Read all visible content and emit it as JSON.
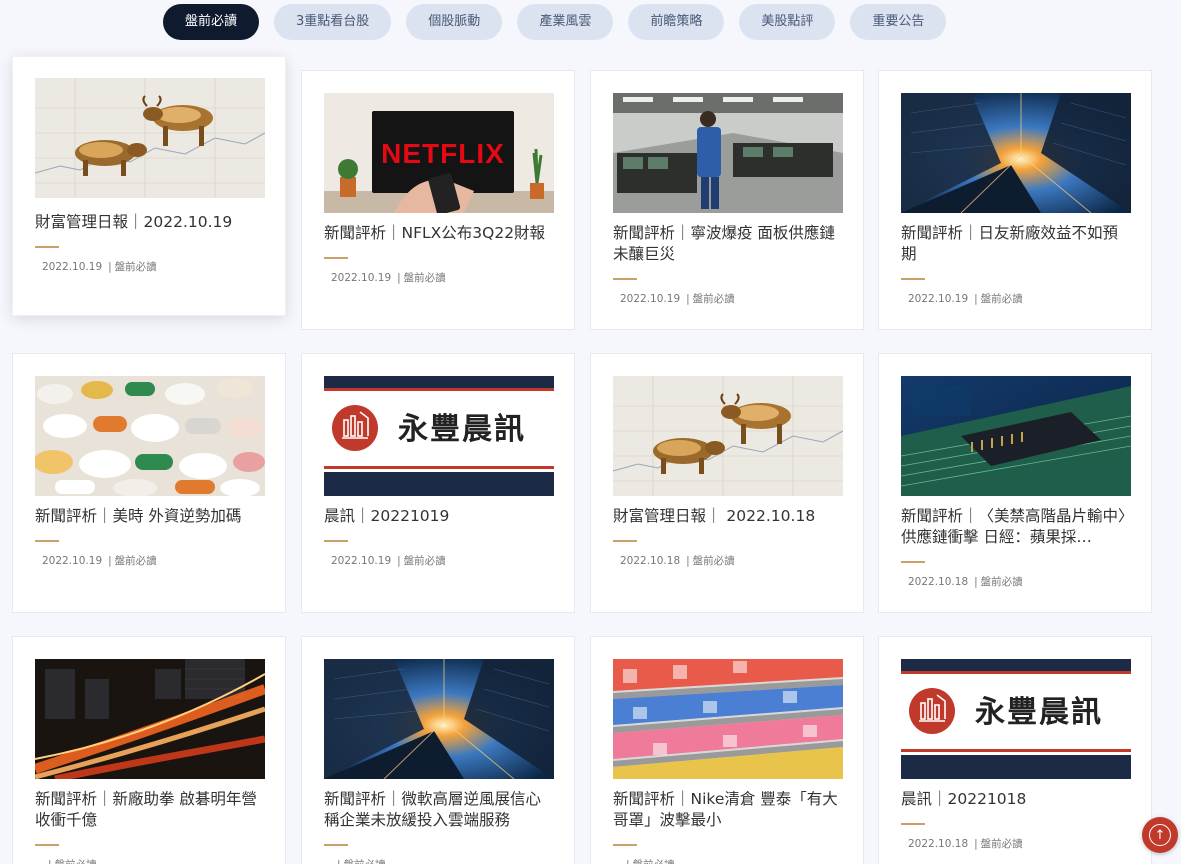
{
  "tabs": [
    "盤前必讀",
    "3重點看台股",
    "個股脈動",
    "產業風雲",
    "前瞻策略",
    "美股點評",
    "重要公告"
  ],
  "active_tab": 0,
  "brand": {
    "name": "永豐晨訊",
    "netflix": "NETFLIX"
  },
  "colors": {
    "accent": "#c9a06a",
    "active_tab": "#0f1a2f",
    "tab_bg": "#dbe3f1",
    "back_to_top": "#c0392b"
  },
  "articles": [
    {
      "title": "財富管理日報｜2022.10.19",
      "date": "2022.10.19",
      "category": "盤前必讀",
      "image": "bulls-icon"
    },
    {
      "title": "新聞評析｜NFLX公布3Q22財報",
      "date": "2022.10.19",
      "category": "盤前必讀",
      "image": "netflix-tv-icon"
    },
    {
      "title": "新聞評析｜寧波爆疫 面板供應鏈未釀巨災",
      "date": "2022.10.19",
      "category": "盤前必讀",
      "image": "factory-icon"
    },
    {
      "title": "新聞評析｜日友新廠效益不如預期",
      "date": "2022.10.19",
      "category": "盤前必讀",
      "image": "skyscrapers-icon"
    },
    {
      "title": "新聞評析｜美時 外資逆勢加碼",
      "date": "2022.10.19",
      "category": "盤前必讀",
      "image": "pills-icon"
    },
    {
      "title": "晨訊｜20221019",
      "date": "2022.10.19",
      "category": "盤前必讀",
      "image": "brand-banner-icon"
    },
    {
      "title": "財富管理日報｜ 2022.10.18",
      "date": "2022.10.18",
      "category": "盤前必讀",
      "image": "bulls-icon"
    },
    {
      "title": "新聞評析｜〈美禁高階晶片輸中〉供應鏈衝擊 日經：蘋果採…",
      "date": "2022.10.18",
      "category": "盤前必讀",
      "image": "circuit-board-icon"
    },
    {
      "title": "新聞評析｜新廠助拳 啟碁明年營收衝千億",
      "date": "",
      "category": "盤前必讀",
      "image": "light-trails-icon"
    },
    {
      "title": "新聞評析｜微軟高層逆風展信心 稱企業未放緩投入雲端服務",
      "date": "",
      "category": "盤前必讀",
      "image": "skyscrapers-icon"
    },
    {
      "title": "新聞評析｜Nike清倉 豐泰「有大哥罩」波擊最小",
      "date": "",
      "category": "盤前必讀",
      "image": "sneakers-icon"
    },
    {
      "title": "晨訊｜20221018",
      "date": "2022.10.18",
      "category": "盤前必讀",
      "image": "brand-banner-icon"
    }
  ],
  "back_to_top_icon": "arrow-up-icon"
}
